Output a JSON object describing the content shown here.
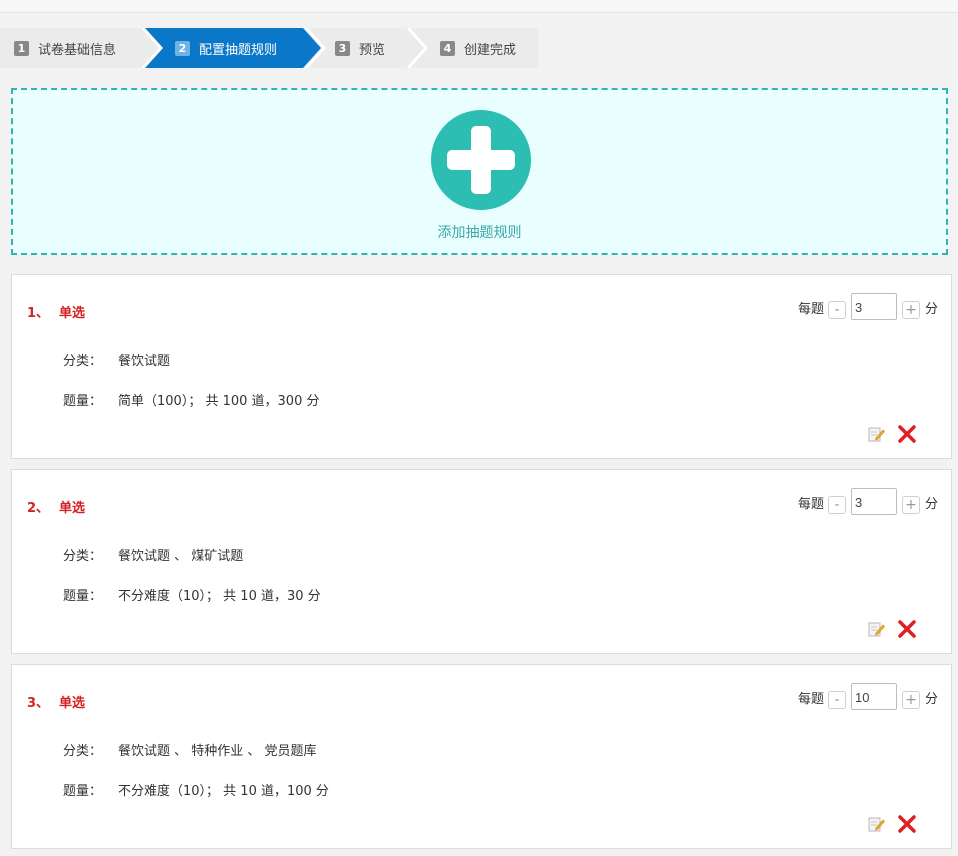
{
  "steps": [
    {
      "num": "1",
      "label": "试卷基础信息"
    },
    {
      "num": "2",
      "label": "配置抽题规则"
    },
    {
      "num": "3",
      "label": "预览"
    },
    {
      "num": "4",
      "label": "创建完成"
    }
  ],
  "add_rule": {
    "label": "添加抽题规则"
  },
  "rules": [
    {
      "index": "1、",
      "type": "单选",
      "score_prefix": "每题",
      "minus": "-",
      "score_value": "3",
      "plus": "+",
      "score_suffix": "分",
      "category_label": "分类：",
      "category_value": "餐饮试题",
      "amount_label": "题量：",
      "amount_value": "简单（100）； 共 100 道，300 分"
    },
    {
      "index": "2、",
      "type": "单选",
      "score_prefix": "每题",
      "minus": "-",
      "score_value": "3",
      "plus": "+",
      "score_suffix": "分",
      "category_label": "分类：",
      "category_value": "餐饮试题 、 煤矿试题",
      "amount_label": "题量：",
      "amount_value": "不分难度（10）； 共 10 道，30 分"
    },
    {
      "index": "3、",
      "type": "单选",
      "score_prefix": "每题",
      "minus": "-",
      "score_value": "10",
      "plus": "+",
      "score_suffix": "分",
      "category_label": "分类：",
      "category_value": "餐饮试题 、 特种作业 、 党员题库",
      "amount_label": "题量：",
      "amount_value": "不分难度（10）； 共 10 道，100 分"
    }
  ],
  "icons": {
    "edit": "edit-icon",
    "delete": "delete-icon",
    "add": "plus-icon"
  },
  "colors": {
    "active_step": "#0b77c8",
    "teal": "#2cbdb3",
    "rule_title": "#d42121",
    "delete": "#e02020"
  }
}
